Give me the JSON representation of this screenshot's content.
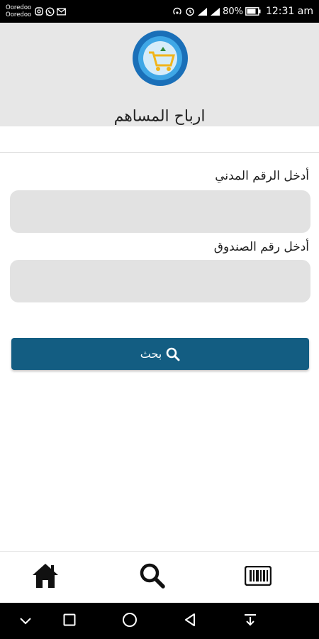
{
  "status_bar": {
    "carrier_1": "Ooredoo",
    "carrier_2": "Ooredoo",
    "battery": "80%",
    "time": "12:31 am"
  },
  "header": {
    "title": "ارباح المساهم",
    "logo_icon": "cooperative-society-logo"
  },
  "form": {
    "civil_id_label": "أدخل الرقم المدني",
    "civil_id_value": "",
    "box_number_label": "أدخل رقم الصندوق",
    "box_number_value": "",
    "search_button_label": "بحث"
  },
  "bottom_nav": {
    "items": [
      {
        "icon": "home-icon"
      },
      {
        "icon": "search-icon"
      },
      {
        "icon": "barcode-icon"
      }
    ]
  },
  "colors": {
    "header_bg": "#e7e7e7",
    "input_bg": "#e2e2e2",
    "button_bg": "#135d82"
  }
}
